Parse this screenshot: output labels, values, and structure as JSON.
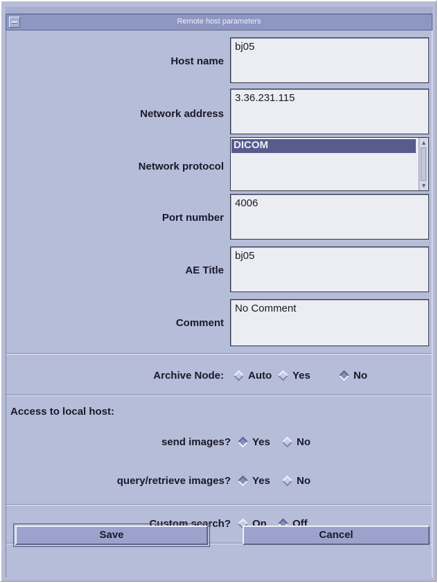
{
  "window": {
    "title": "Remote host parameters"
  },
  "fields": {
    "host_name": {
      "label": "Host name",
      "value": "bj05"
    },
    "network_address": {
      "label": "Network address",
      "value": "3.36.231.115"
    },
    "network_protocol": {
      "label": "Network protocol",
      "selected": "DICOM"
    },
    "port_number": {
      "label": "Port number",
      "value": "4006"
    },
    "ae_title": {
      "label": "AE Title",
      "value": "bj05"
    },
    "comment": {
      "label": "Comment",
      "value": "No Comment"
    }
  },
  "archive_node": {
    "label": "Archive Node:",
    "options": [
      "Auto",
      "Yes",
      "No"
    ],
    "selected": "No"
  },
  "access": {
    "title": "Access to local host:",
    "send_images": {
      "label": "send images?",
      "options": [
        "Yes",
        "No"
      ],
      "selected": "Yes"
    },
    "query_retrieve": {
      "label": "query/retrieve images?",
      "options": [
        "Yes",
        "No"
      ],
      "selected": "Yes"
    }
  },
  "custom_search": {
    "label": "Custom search?",
    "options": [
      "On",
      "Off"
    ],
    "selected": "Off"
  },
  "buttons": {
    "save": "Save",
    "cancel": "Cancel"
  },
  "colors": {
    "background": "#b6bdd8",
    "selection": "#5a5b8c",
    "field_bg": "#ecedf3"
  }
}
